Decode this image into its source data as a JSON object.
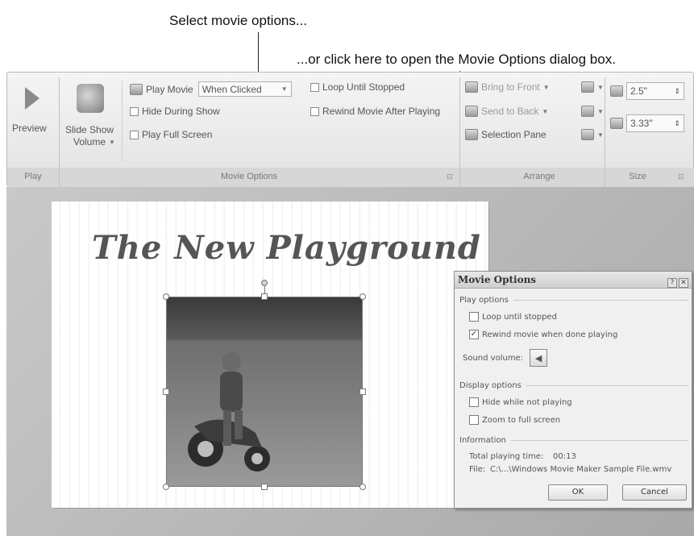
{
  "callouts": {
    "select": "Select movie options...",
    "dialog": "...or click here to open the Movie Options dialog box."
  },
  "ribbon": {
    "play_group": {
      "preview_label": "Preview",
      "group_label": "Play"
    },
    "movie_options": {
      "slide_show_volume_label": "Slide Show",
      "slide_show_volume_label2": "Volume",
      "play_movie_label": "Play Movie",
      "play_movie_value": "When Clicked",
      "hide_during_show": "Hide During Show",
      "play_full_screen": "Play Full Screen",
      "loop_until_stopped": "Loop Until Stopped",
      "rewind_after_playing": "Rewind Movie After Playing",
      "group_label": "Movie Options"
    },
    "arrange": {
      "bring_to_front": "Bring to Front",
      "send_to_back": "Send to Back",
      "selection_pane": "Selection Pane",
      "group_label": "Arrange"
    },
    "size": {
      "height_value": "2.5\"",
      "width_value": "3.33\"",
      "group_label": "Size"
    }
  },
  "slide": {
    "title": "The New Playground"
  },
  "dialog": {
    "title": "Movie Options",
    "play_options_label": "Play options",
    "loop_until_stopped": "Loop until stopped",
    "loop_checked": false,
    "rewind_when_done": "Rewind movie when done playing",
    "rewind_checked": true,
    "sound_volume_label": "Sound volume:",
    "display_options_label": "Display options",
    "hide_while_not_playing": "Hide while not playing",
    "zoom_to_full_screen": "Zoom to full screen",
    "information_label": "Information",
    "total_playing_time_label": "Total playing time:",
    "total_playing_time_value": "00:13",
    "file_label": "File:",
    "file_value": "C:\\...\\Windows Movie Maker Sample File.wmv",
    "ok_label": "OK",
    "cancel_label": "Cancel"
  }
}
